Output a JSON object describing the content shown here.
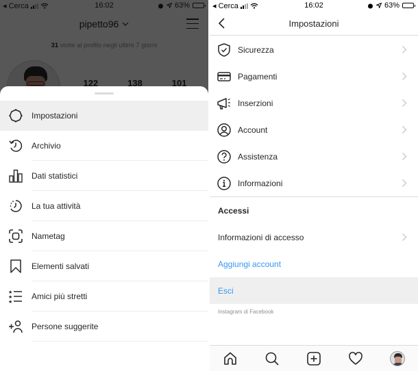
{
  "left": {
    "status_bar": {
      "carrier": "◂ Cerca",
      "time": "16:02",
      "battery": "63%",
      "battery_level": 0.63
    },
    "profile": {
      "username": "pipetto96",
      "visits_count": "31",
      "visits_text": " visite al profilo negli ultimi 7 giorni",
      "stats": [
        "122",
        "138",
        "101"
      ]
    },
    "menu": {
      "items": [
        {
          "label": "Impostazioni",
          "icon": "gear-icon",
          "active": true
        },
        {
          "label": "Archivio",
          "icon": "archive-clock-icon"
        },
        {
          "label": "Dati statistici",
          "icon": "bar-chart-icon"
        },
        {
          "label": "La tua attività",
          "icon": "activity-clock-icon"
        },
        {
          "label": "Nametag",
          "icon": "nametag-scan-icon"
        },
        {
          "label": "Elementi salvati",
          "icon": "bookmark-icon"
        },
        {
          "label": "Amici più stretti",
          "icon": "close-friends-list-icon"
        },
        {
          "label": "Persone suggerite",
          "icon": "add-person-icon"
        }
      ]
    }
  },
  "right": {
    "status_bar": {
      "carrier": "◂ Cerca",
      "time": "16:02",
      "battery": "63%",
      "battery_level": 0.63
    },
    "nav": {
      "title": "Impostazioni"
    },
    "settings": [
      {
        "label": "Sicurezza",
        "icon": "shield-check-icon"
      },
      {
        "label": "Pagamenti",
        "icon": "credit-card-icon"
      },
      {
        "label": "Inserzioni",
        "icon": "megaphone-icon"
      },
      {
        "label": "Account",
        "icon": "user-circle-icon"
      },
      {
        "label": "Assistenza",
        "icon": "help-circle-icon"
      },
      {
        "label": "Informazioni",
        "icon": "info-circle-icon"
      }
    ],
    "access_section": {
      "title": "Accessi",
      "login_info": "Informazioni di accesso",
      "add_account": "Aggiungi account",
      "logout": "Esci"
    },
    "footer": "Instagram di Facebook",
    "tabbar": [
      "home-icon",
      "search-icon",
      "new-post-icon",
      "activity-heart-icon",
      "profile-avatar"
    ]
  },
  "colors": {
    "link_blue": "#3897f0",
    "text": "#262626",
    "secondary_text": "#8e8e8e",
    "pressed_bg": "#efefef"
  }
}
